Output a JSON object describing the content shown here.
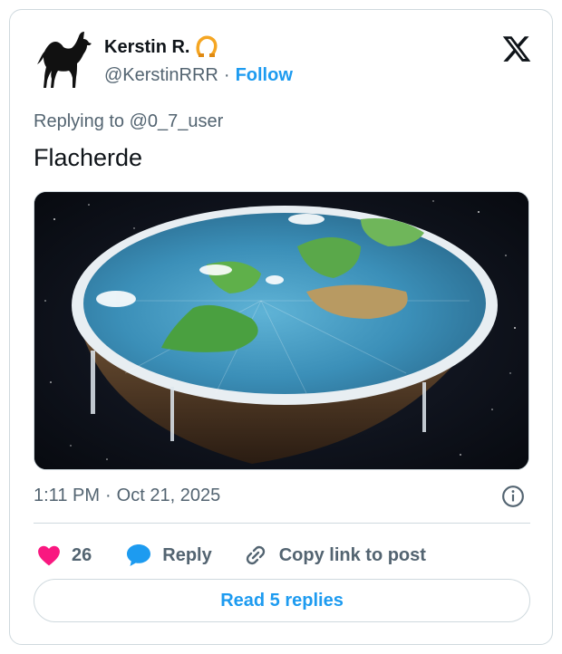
{
  "author": {
    "display_name": "Kerstin R.",
    "handle": "@KerstinRRR",
    "separator": "·",
    "follow_label": "Follow",
    "avatar_icon": "camel-icon",
    "badge_icon": "horseshoe-badge-icon"
  },
  "brand": {
    "logo_icon": "x-logo-icon"
  },
  "tweet": {
    "reply_prefix": "Replying to",
    "reply_to": "@0_7_user",
    "text": "Flacherde",
    "media_icon": "flat-earth-image"
  },
  "meta": {
    "time": "1:11 PM",
    "separator": "·",
    "date": "Oct 21, 2025",
    "info_icon": "info-icon"
  },
  "actions": {
    "like_count": "26",
    "reply_label": "Reply",
    "copy_label": "Copy link to post"
  },
  "footer": {
    "read_replies_label": "Read 5 replies"
  },
  "colors": {
    "accent": "#1d9bf0",
    "like": "#f91880",
    "muted": "#536471",
    "border": "#cfd9de",
    "badge": "#f5a623"
  }
}
